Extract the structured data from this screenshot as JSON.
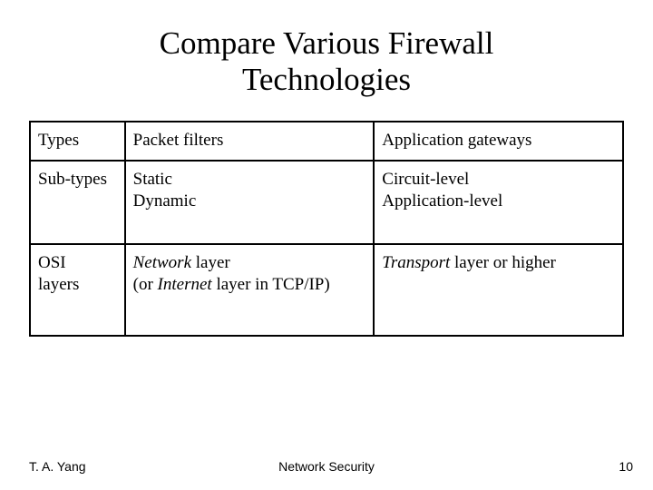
{
  "title_line1": "Compare Various Firewall",
  "title_line2": "Technologies",
  "table": {
    "rows": {
      "types": {
        "label": "Types",
        "col_b": "Packet filters",
        "col_c": "Application gateways"
      },
      "subtypes": {
        "label": "Sub-types",
        "col_b_1": "Static",
        "col_b_2": "Dynamic",
        "col_c_1": "Circuit-level",
        "col_c_2": "Application-level"
      },
      "osi": {
        "label_1": "OSI",
        "label_2": "layers",
        "col_b_italic1": "Network",
        "col_b_plain1": " layer",
        "col_b_plain2": "(or ",
        "col_b_italic2": "Internet",
        "col_b_plain3": " layer in TCP/IP)",
        "col_c_italic": "Transport",
        "col_c_plain": " layer or higher"
      }
    }
  },
  "footer": {
    "author": "T. A. Yang",
    "center": "Network Security",
    "page": "10"
  }
}
